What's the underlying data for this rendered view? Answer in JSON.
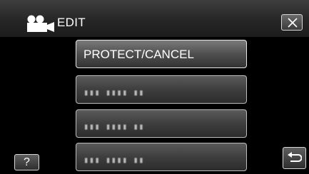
{
  "header": {
    "title": "EDIT",
    "mode_icon": "video-camera-icon",
    "close_icon": "close-icon"
  },
  "menu": {
    "items": [
      {
        "label": "PROTECT/CANCEL",
        "state": "selected"
      },
      {
        "label": "▮▮▮ ▮▮▮▮ ▮▮",
        "state": "unreadable"
      },
      {
        "label": "▮▮▮ ▮▮▮▮ ▮▮",
        "state": "unreadable"
      },
      {
        "label": "▮▮▮ ▮▮▮▮ ▮▮",
        "state": "unreadable"
      }
    ]
  },
  "footer": {
    "help_label": "?",
    "help_icon": "help-icon",
    "return_icon": "return-arrow-icon"
  },
  "colors": {
    "background": "#000000",
    "header": "#2a2a2a",
    "button": "#444444",
    "button_border": "#bdbdbd",
    "text": "#ffffff"
  }
}
